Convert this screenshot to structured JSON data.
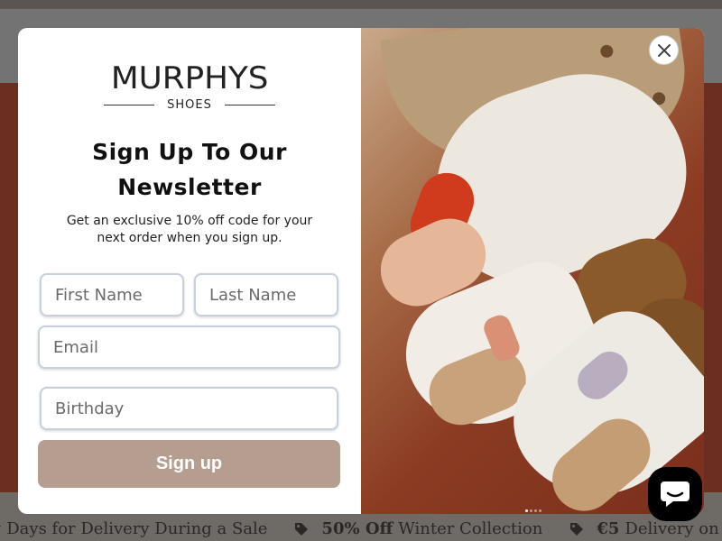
{
  "popup": {
    "logo_main": "MURPHYS",
    "logo_sub": "SHOES",
    "title": "Sign Up To Our Newsletter",
    "subtitle": "Get an exclusive 10% off code for your next order when you sign up.",
    "fields": {
      "first_name_placeholder": "First Name",
      "last_name_placeholder": "Last Name",
      "email_placeholder": "Email",
      "birthday_placeholder": "Birthday"
    },
    "signup_label": "Sign up",
    "carousel_dots": 4,
    "active_dot": 0,
    "close_icon": "close-icon"
  },
  "ticker": {
    "items": [
      {
        "bold": "",
        "text": "g Days for Delivery During a Sale"
      },
      {
        "bold": "50% Off",
        "text": "Winter Collection"
      },
      {
        "bold": "€5",
        "text": "Delivery on Sale Items"
      }
    ]
  },
  "chat": {
    "icon": "chat-icon"
  },
  "colors": {
    "button": "#b59d8f",
    "field_border": "#c8d0dc",
    "overlay": "#6b6b6b"
  }
}
